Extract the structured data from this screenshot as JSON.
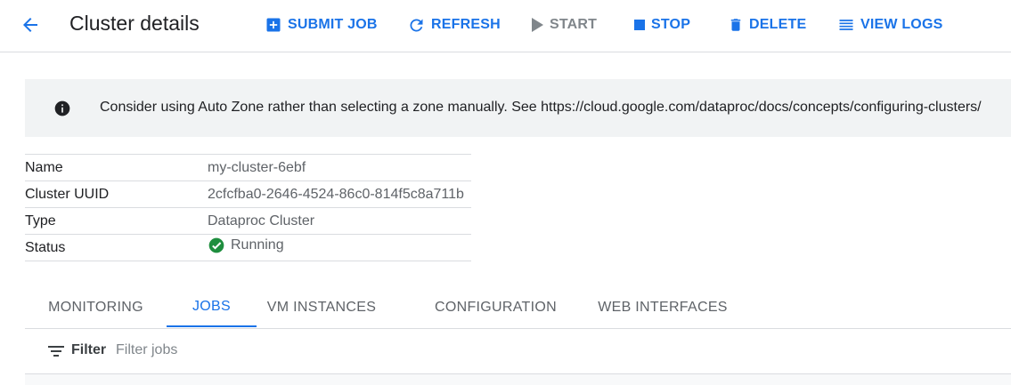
{
  "header": {
    "title": "Cluster details",
    "actions": {
      "submit_job": "SUBMIT JOB",
      "refresh": "REFRESH",
      "start": "START",
      "stop": "STOP",
      "delete": "DELETE",
      "view_logs": "VIEW LOGS"
    }
  },
  "banner": {
    "message": "Consider using Auto Zone rather than selecting a zone manually. See https://cloud.google.com/dataproc/docs/concepts/configuring-clusters/"
  },
  "properties": [
    {
      "key": "Name",
      "value": "my-cluster-6ebf"
    },
    {
      "key": "Cluster UUID",
      "value": "2cfcfba0-2646-4524-86c0-814f5c8a711b"
    },
    {
      "key": "Type",
      "value": "Dataproc Cluster"
    },
    {
      "key": "Status",
      "value": "Running"
    }
  ],
  "tabs": [
    {
      "label": "MONITORING"
    },
    {
      "label": "JOBS"
    },
    {
      "label": "VM INSTANCES"
    },
    {
      "label": "CONFIGURATION"
    },
    {
      "label": "WEB INTERFACES"
    }
  ],
  "filter": {
    "label": "Filter",
    "placeholder": "Filter jobs"
  },
  "colors": {
    "accent": "#1a73e8",
    "success": "#1e8e3e",
    "banner_bg": "#f1f3f4"
  },
  "icons": [
    "back-arrow-icon",
    "add-box-icon",
    "refresh-icon",
    "play-icon",
    "stop-icon",
    "trash-icon",
    "list-icon",
    "info-icon",
    "check-circle-icon",
    "filter-icon"
  ]
}
